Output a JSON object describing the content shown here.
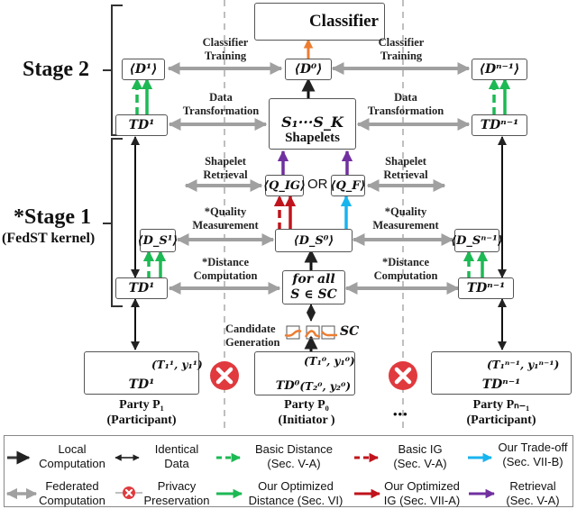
{
  "stages": {
    "stage2": "Stage 2",
    "stage1": "*Stage 1",
    "stage1_sub": "(FedST kernel)"
  },
  "nodes": {
    "classifier": "Classifier",
    "d1": "⟨D¹⟩",
    "d0": "⟨D⁰⟩",
    "dn1": "⟨Dⁿ⁻¹⟩",
    "td1_top": "TD¹",
    "tdn1_top": "TDⁿ⁻¹",
    "shapelets_formula": "S₁···S_K",
    "shapelets_label": "Shapelets",
    "q_ig": "⟨Q_IG⟩",
    "or": "OR",
    "q_f": "⟨Q_F⟩",
    "ds1": "⟨D_S¹⟩",
    "ds0": "⟨D_S⁰⟩",
    "dsn1": "⟨D_Sⁿ⁻¹⟩",
    "td1_bottom": "TD¹",
    "tdn1_bottom": "TDⁿ⁻¹",
    "forall_line1": "for all",
    "forall_line2": "S ∈ SC",
    "sc": "SC"
  },
  "edge_labels": {
    "classifier_training_left": [
      "Classifier",
      "Training"
    ],
    "classifier_training_right": [
      "Classifier",
      "Training"
    ],
    "data_transformation_left": [
      "Data",
      "Transformation"
    ],
    "data_transformation_right": [
      "Data",
      "Transformation"
    ],
    "shapelet_retrieval_left": [
      "Shapelet",
      "Retrieval"
    ],
    "shapelet_retrieval_right": [
      "Shapelet",
      "Retrieval"
    ],
    "quality_left": [
      "*Quality",
      "Measurement"
    ],
    "quality_right": [
      "*Quality",
      "Measurement"
    ],
    "distance_left": [
      "*Distance",
      "Computation"
    ],
    "distance_right": [
      "*Distance",
      "Computation"
    ],
    "candidate": [
      "Candidate",
      "Generation"
    ]
  },
  "parties": [
    {
      "series_label": "(T₁¹, y₁¹)",
      "dataset": "TD¹",
      "name": "Party P₁",
      "role": "(Participant)"
    },
    {
      "series_label_1": "(T₁⁰, y₁⁰)",
      "series_label_2": "(T₂⁰, y₂⁰)",
      "dataset": "TD⁰",
      "name": "Party P₀",
      "role": "(Initiator )"
    },
    {
      "series_label": "(T₁ⁿ⁻¹, y₁ⁿ⁻¹)",
      "dataset": "TDⁿ⁻¹",
      "name": "Party Pₙ₋₁",
      "role": "(Participant)"
    }
  ],
  "ellipsis": "•••",
  "legend": [
    {
      "label": [
        "Local",
        "Computation"
      ],
      "icon": "dark-solid-arrow"
    },
    {
      "label": [
        "Identical",
        "Data"
      ],
      "icon": "double-headed-arrow"
    },
    {
      "label": [
        "Basic Distance",
        "(Sec. V-A)"
      ],
      "icon": "green-dashed-arrow"
    },
    {
      "label": [
        "Basic IG",
        "(Sec. V-A)"
      ],
      "icon": "red-dashed-arrow"
    },
    {
      "label": [
        "Our Trade-off",
        "(Sec. VII-B)"
      ],
      "icon": "blue-arrow"
    },
    {
      "label": [
        "Federated",
        "Computation"
      ],
      "icon": "gray-double-arrow"
    },
    {
      "label": [
        "Privacy",
        "Preservation"
      ],
      "icon": "privacy-cross"
    },
    {
      "label": [
        "Our Optimized",
        "Distance (Sec. VI)"
      ],
      "icon": "green-solid-arrow"
    },
    {
      "label": [
        "Our Optimized",
        "IG (Sec. VII-A)"
      ],
      "icon": "red-solid-arrow"
    },
    {
      "label": [
        "Retrieval",
        "(Sec. V-A)"
      ],
      "icon": "purple-arrow"
    }
  ],
  "colors": {
    "local": "#3a3a3a",
    "federated": "#a0a0a0",
    "green": "#1db954",
    "red": "#c0141c",
    "blue": "#18b4ee",
    "purple": "#7030a0",
    "orange": "#ed7d31",
    "privacy": "#e03a3e",
    "divider": "#aaaaaa"
  }
}
